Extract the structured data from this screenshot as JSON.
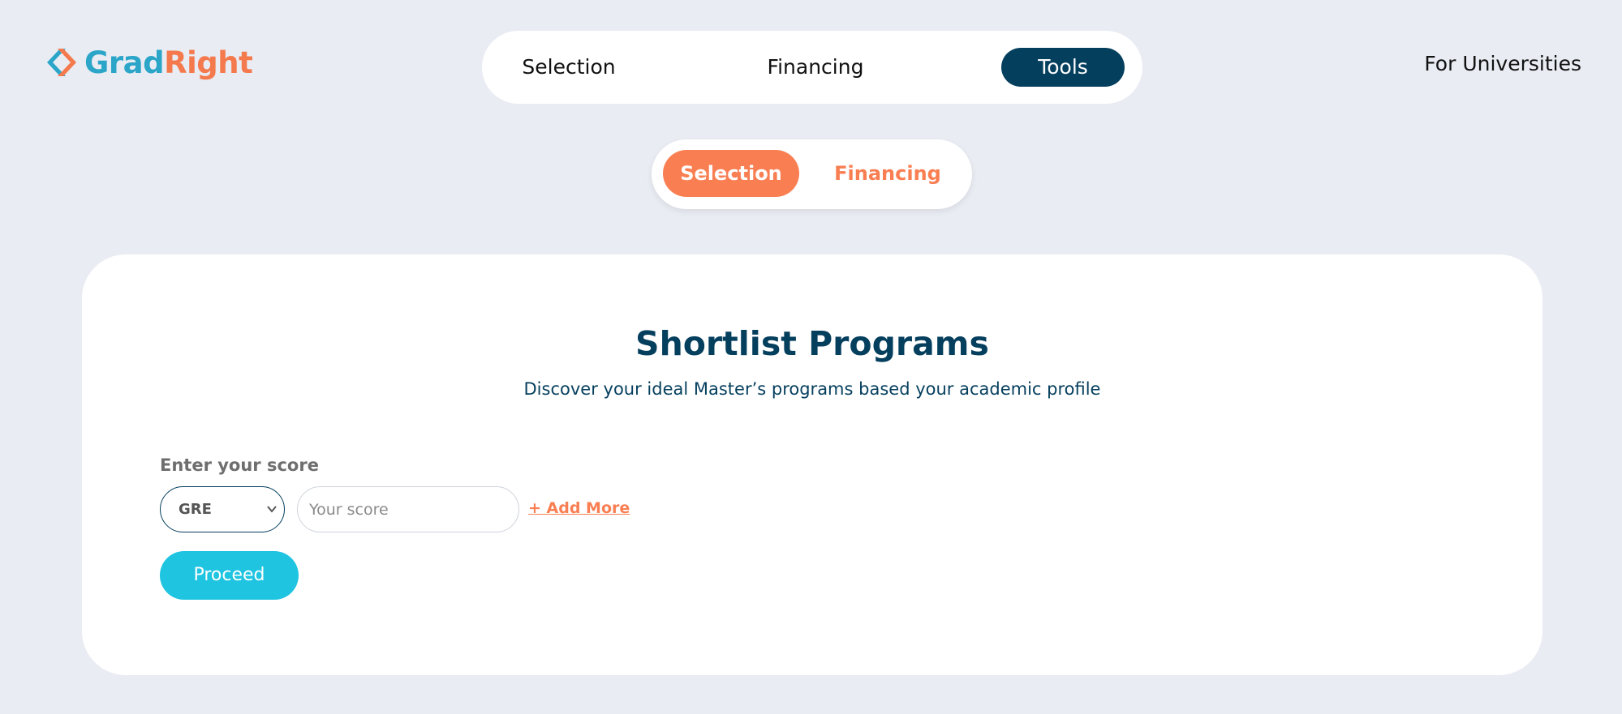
{
  "logo": {
    "part1": "Grad",
    "part2": "Right"
  },
  "topnav": {
    "items": [
      "Selection",
      "Financing",
      "Tools"
    ],
    "active": "Tools"
  },
  "header": {
    "for_universities": "For Universities"
  },
  "subtabs": {
    "items": [
      "Selection",
      "Financing"
    ],
    "active": "Selection"
  },
  "card": {
    "title": "Shortlist Programs",
    "subtitle": "Discover your ideal Master’s programs based your academic profile",
    "score_label": "Enter your score",
    "test_select": {
      "selected": "GRE"
    },
    "score_input": {
      "placeholder": "Your score",
      "value": ""
    },
    "add_more": "+ Add More",
    "proceed": "Proceed"
  },
  "colors": {
    "background": "#e9ecf3",
    "brand_navy": "#053f5e",
    "brand_orange": "#f97e52",
    "brand_teal": "#2ba5c8",
    "proceed_cyan": "#1fc4e1"
  },
  "icons": {
    "logo_mark": "chevron-brackets-icon",
    "select_arrow": "chevron-down-icon"
  }
}
